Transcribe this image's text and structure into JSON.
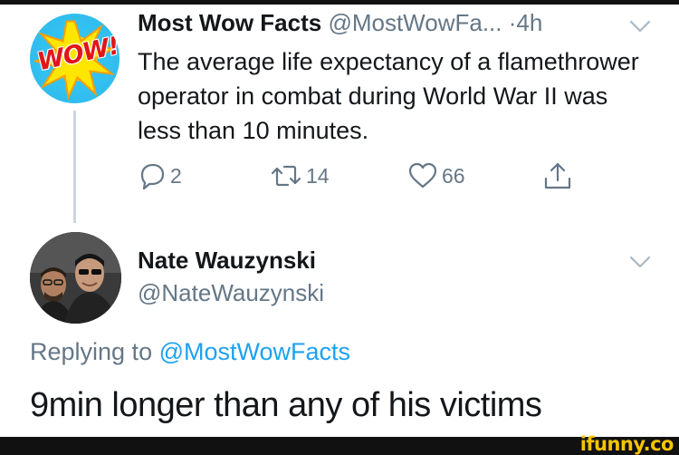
{
  "tweet1": {
    "name": "Most Wow Facts",
    "handle": "@MostWowFa...",
    "separator": "·",
    "time": "4h",
    "avatar_text": "WOW!",
    "text": "The average life expectancy of a flamethrower operator in combat during World War II was less than 10 minutes.",
    "actions": {
      "reply_count": "2",
      "retweet_count": "14",
      "like_count": "66"
    }
  },
  "tweet2": {
    "name": "Nate Wauzynski",
    "handle": "@NateWauzynski",
    "replying_prefix": "Replying to ",
    "replying_to": "@MostWowFacts",
    "text": "9min longer than any of his victims"
  },
  "watermark": "ifunny.co",
  "colors": {
    "accent": "#1da1f2",
    "secondary_text": "#657786",
    "watermark": "#f5c400"
  },
  "icons": [
    "reply-icon",
    "retweet-icon",
    "like-icon",
    "share-icon",
    "chevron-down-icon"
  ]
}
